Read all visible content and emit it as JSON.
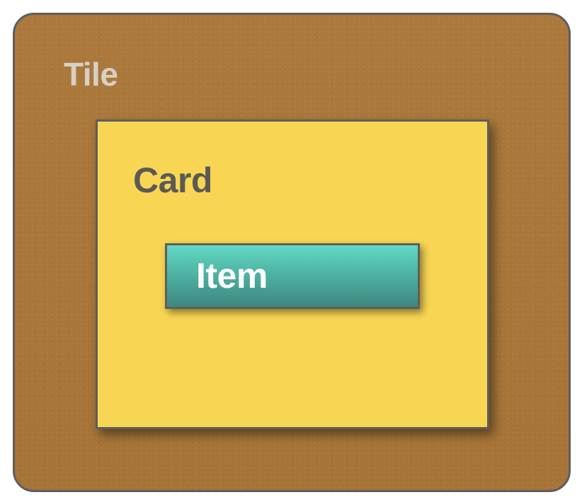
{
  "tile": {
    "label": "Tile",
    "color": "#a8763a"
  },
  "card": {
    "label": "Card",
    "color": "#f8d654"
  },
  "item": {
    "label": "Item",
    "color": "#4fb3a3"
  }
}
